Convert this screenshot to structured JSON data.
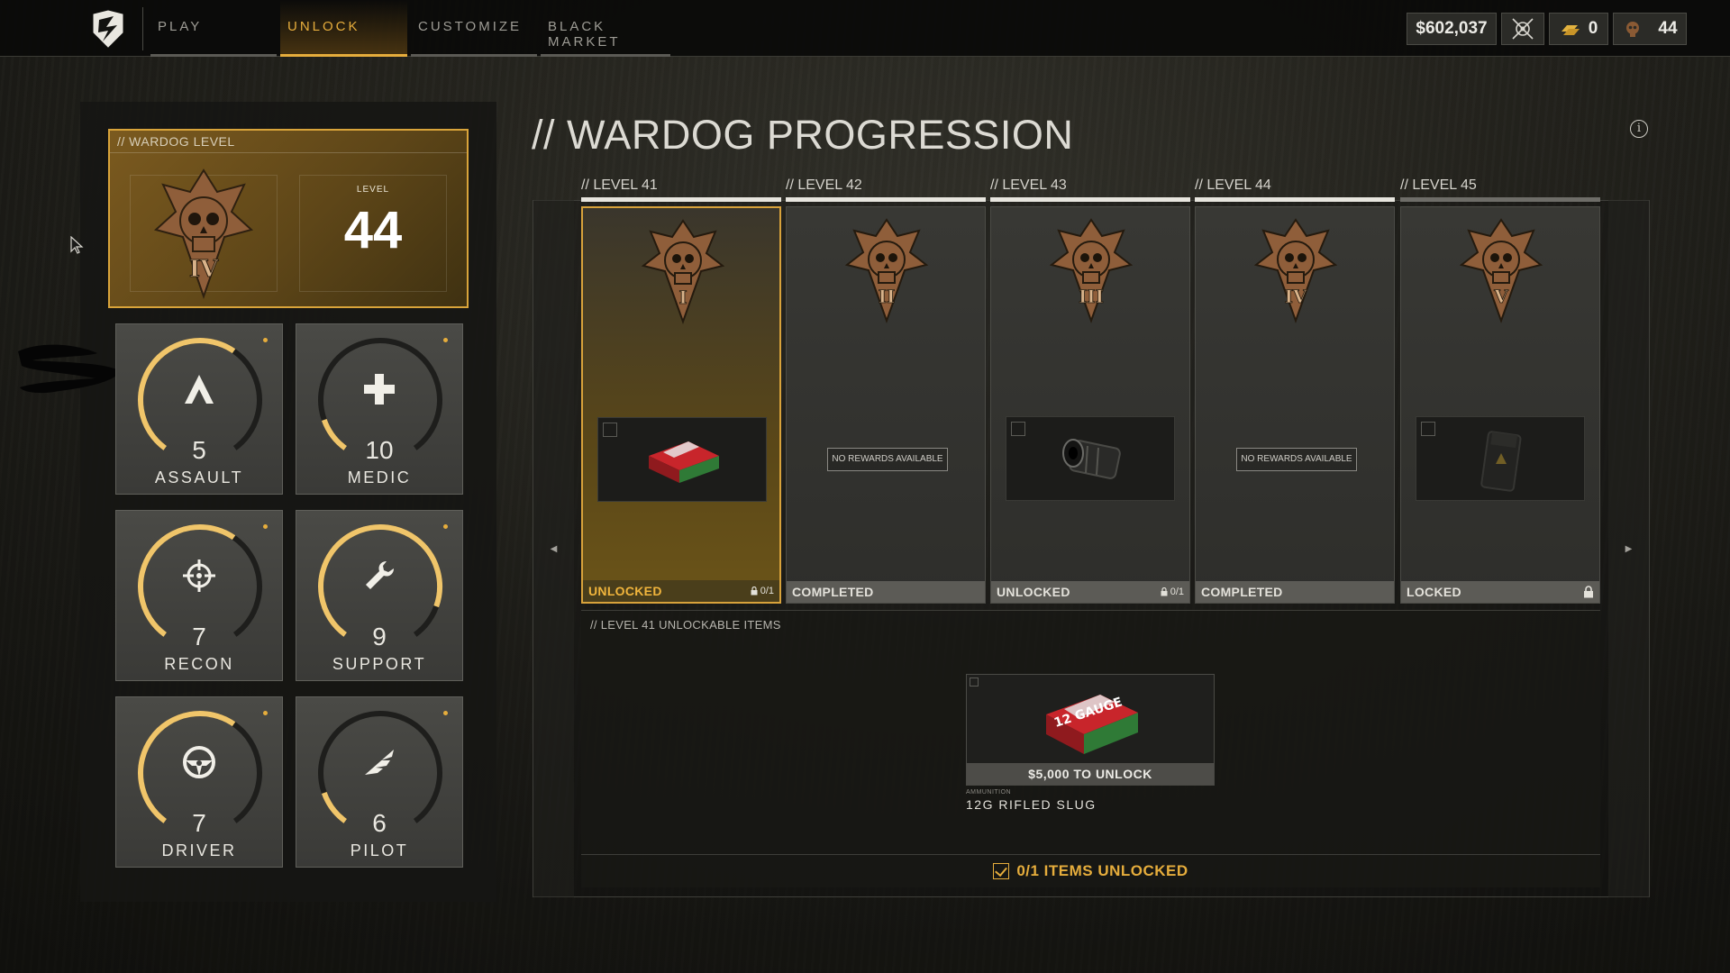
{
  "nav": {
    "tabs": [
      {
        "label": "PLAY"
      },
      {
        "label": "UNLOCK"
      },
      {
        "label": "CUSTOMIZE"
      },
      {
        "label": "BLACK MARKET"
      }
    ],
    "active_tab": "UNLOCK"
  },
  "currencies": {
    "money": "$602,037",
    "gold": "0",
    "wardog_level": "44"
  },
  "wardog": {
    "header": "// WARDOG LEVEL",
    "level_label": "LEVEL",
    "level_value": "44",
    "emblem_numeral": "IV"
  },
  "classes": [
    {
      "name": "ASSAULT",
      "level": "5",
      "icon": "chevron-up-icon",
      "progress": 0.62
    },
    {
      "name": "MEDIC",
      "level": "10",
      "icon": "plus-icon",
      "progress": 0.12
    },
    {
      "name": "RECON",
      "level": "7",
      "icon": "crosshair-icon",
      "progress": 0.62
    },
    {
      "name": "SUPPORT",
      "level": "9",
      "icon": "wrench-icon",
      "progress": 0.88
    },
    {
      "name": "DRIVER",
      "level": "7",
      "icon": "steering-wheel-icon",
      "progress": 0.62
    },
    {
      "name": "PILOT",
      "level": "6",
      "icon": "wing-icon",
      "progress": 0.12
    }
  ],
  "main": {
    "title": "// WARDOG PROGRESSION"
  },
  "levels": [
    {
      "label": "// LEVEL 41",
      "numeral": "I",
      "status": "UNLOCKED",
      "count": "0/1",
      "reward": "ammo-box"
    },
    {
      "label": "// LEVEL 42",
      "numeral": "II",
      "status": "COMPLETED",
      "count": "",
      "reward": "none"
    },
    {
      "label": "// LEVEL 43",
      "numeral": "III",
      "status": "UNLOCKED",
      "count": "0/1",
      "reward": "muzzle"
    },
    {
      "label": "// LEVEL 44",
      "numeral": "IV",
      "status": "COMPLETED",
      "count": "",
      "reward": "none"
    },
    {
      "label": "// LEVEL 45",
      "numeral": "V",
      "status": "LOCKED",
      "count": "",
      "reward": "pouch"
    }
  ],
  "no_rewards_text": "NO REWARDS AVAILABLE",
  "unlock_panel": {
    "title": "// LEVEL 41 UNLOCKABLE ITEMS",
    "item_price": "$5,000 TO UNLOCK",
    "item_category": "AMMUNITION",
    "item_name": "12G RIFLED SLUG",
    "items_unlocked": "0/1 ITEMS UNLOCKED"
  },
  "colors": {
    "accent": "#e6ad3c",
    "panel": "#161613",
    "card": "#3a3a37"
  }
}
